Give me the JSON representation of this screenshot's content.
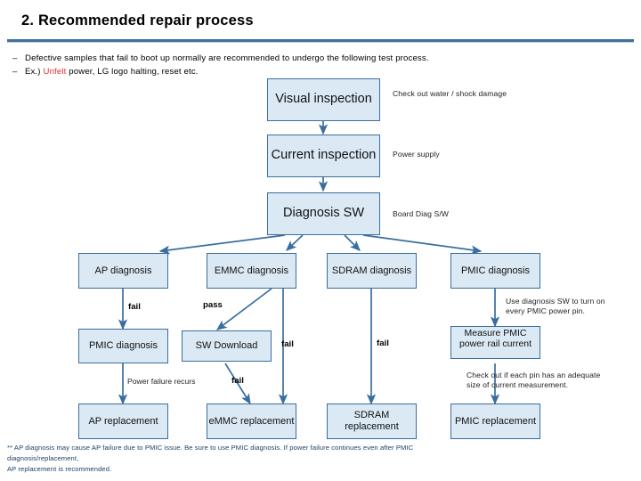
{
  "slide": {
    "title": "2. Recommended repair process",
    "accent_color": "#3a6e9e",
    "box_fill": "#dbe9f4",
    "bullets": [
      {
        "dash": "–",
        "text": "Defective samples that fail to boot up normally are recommended to undergo the following test process."
      },
      {
        "dash": "–",
        "pre": "Ex.) ",
        "highlight": "Unfelt",
        "post": " power, LG logo halting, reset etc.",
        "highlight_color": "#e03030"
      }
    ],
    "footnote": [
      "** AP diagnosis may cause AP failure due to PMIC issue. Be sure to use PMIC diagnosis. If power failure continues even after PMIC",
      "diagnosis/replacement,",
      "AP replacement is recommended."
    ]
  },
  "flow": {
    "boxes": [
      {
        "id": "visual_inspection",
        "label": "Visual inspection"
      },
      {
        "id": "current_inspection",
        "label": "Current inspection"
      },
      {
        "id": "diagnosis_sw",
        "label": "Diagnosis SW"
      },
      {
        "id": "ap_diagnosis",
        "label": "AP diagnosis"
      },
      {
        "id": "emmc_diagnosis",
        "label": "EMMC diagnosis"
      },
      {
        "id": "sdram_diagnosis",
        "label": "SDRAM diagnosis"
      },
      {
        "id": "pmic_diagnosis",
        "label": "PMIC diagnosis"
      },
      {
        "id": "pmic_diagnosis_2",
        "label": "PMIC diagnosis"
      },
      {
        "id": "sw_download",
        "label": "SW Download"
      },
      {
        "id": "measure_pmic",
        "label": "Measure PMIC power rail current"
      },
      {
        "id": "ap_replacement",
        "label": "AP replacement"
      },
      {
        "id": "emmc_replacement",
        "label": "eMMC replacement"
      },
      {
        "id": "sdram_replacement",
        "label": "SDRAM replacement"
      },
      {
        "id": "pmic_replacement",
        "label": "PMIC replacement"
      }
    ],
    "notes": [
      {
        "id": "note_visual",
        "text": "Check out water / shock damage"
      },
      {
        "id": "note_current",
        "text": "Power supply"
      },
      {
        "id": "note_diag",
        "text": "Board Diag S/W"
      },
      {
        "id": "note_pmic",
        "text": "Use diagnosis SW to turn on\nevery PMIC power pin."
      },
      {
        "id": "note_measure",
        "text": "Check out if each pin has an adequate\nsize of current measurement."
      }
    ],
    "edge_labels": [
      {
        "id": "label_ap_fail",
        "text": "fail"
      },
      {
        "id": "label_emmc_pass",
        "text": "pass"
      },
      {
        "id": "label_emmc_fail",
        "text": "fail"
      },
      {
        "id": "label_sdram_fail",
        "text": "fail"
      },
      {
        "id": "label_power_recurs",
        "text": "Power failure recurs"
      },
      {
        "id": "label_sw_fail",
        "text": "fail"
      }
    ]
  }
}
